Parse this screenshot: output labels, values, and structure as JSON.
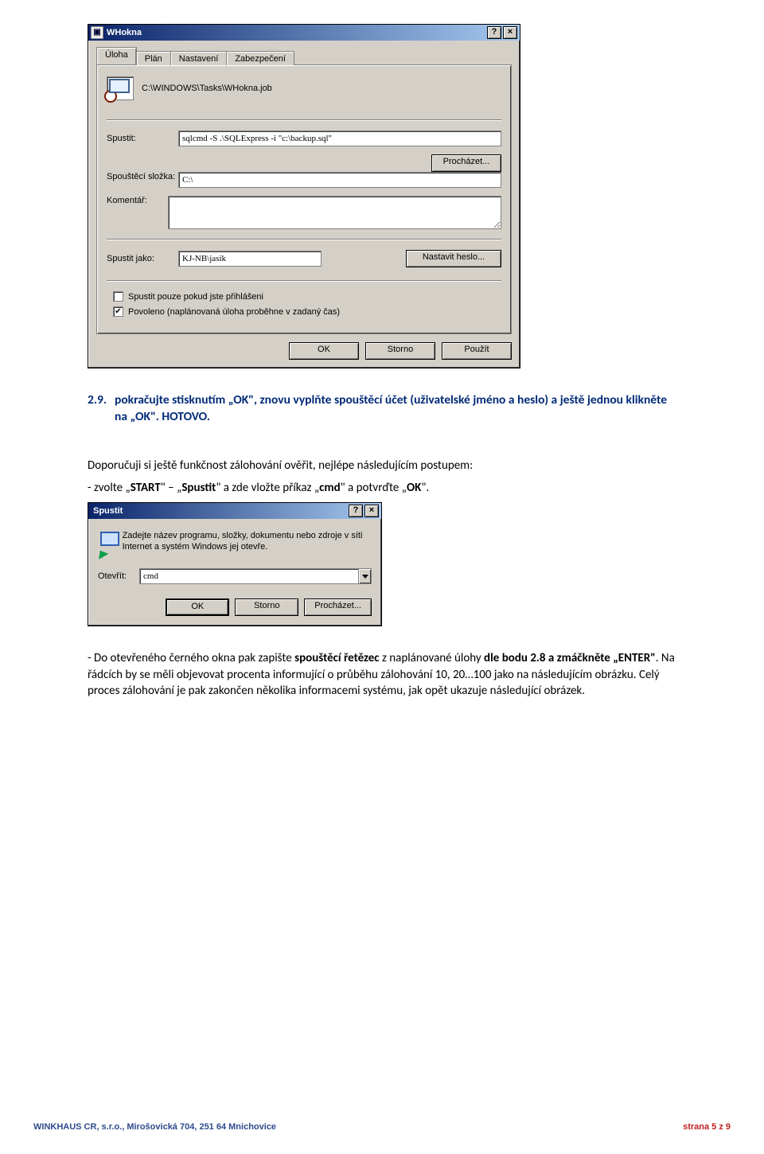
{
  "dialog1": {
    "title": "WHokna",
    "help": "?",
    "close": "×",
    "tabs": [
      "Úloha",
      "Plán",
      "Nastavení",
      "Zabezpečení"
    ],
    "path": "C:\\WINDOWS\\Tasks\\WHokna.job",
    "labels": {
      "spustit": "Spustit:",
      "browse": "Procházet...",
      "startfolder": "Spouštěcí složka:",
      "comment": "Komentář:",
      "runas": "Spustit jako:",
      "setpass": "Nastavit heslo..."
    },
    "values": {
      "command": "sqlcmd -S .\\SQLExpress -i \"c:\\backup.sql\"",
      "folder": "C:\\",
      "runas": "KJ-NB\\jasik"
    },
    "checks": {
      "only_logged": "Spustit pouze pokud jste přihlášeni",
      "enabled": "Povoleno (naplánovaná úloha proběhne v zadaný čas)"
    },
    "buttons": {
      "ok": "OK",
      "storno": "Storno",
      "pouzit": "Použít"
    }
  },
  "doc": {
    "step_num": "2.9.",
    "step_text": "pokračujte stisknutím „OK\", znovu vyplňte spouštěcí účet (uživatelské jméno a heslo) a ještě jednou klikněte na „OK\". HOTOVO.",
    "para1_pre": "Doporučuji si ještě funkčnost zálohování ověřit, nejlépe následujícím postupem:",
    "para1_bullet": "- zvolte „",
    "para1_b1": "START",
    "para1_m1": "\" – „",
    "para1_b2": "Spustit",
    "para1_m2": "\" a zde vložte příkaz „",
    "para1_b3": "cmd",
    "para1_m3": "\" a potvrďte „",
    "para1_b4": "OK",
    "para1_m4": "\".",
    "para2_a": "- Do otevřeného černého okna pak zapište ",
    "para2_b1": "spouštěcí řetězec",
    "para2_b": " z naplánované úlohy ",
    "para2_b2": "dle bodu 2.8 a zmáčkněte „ENTER\"",
    "para2_c": ". Na řádcích by se měli objevovat procenta informující o průběhu zálohování 10, 20…100 jako na následujícím obrázku. Celý proces zálohování je pak zakončen několika informacemi systému, jak opět ukazuje následující obrázek."
  },
  "runDialog": {
    "title": "Spustit",
    "help": "?",
    "close": "×",
    "text": "Zadejte název programu, složky, dokumentu nebo zdroje v síti Internet a systém Windows jej otevře.",
    "openLabel": "Otevřít:",
    "value": "cmd",
    "buttons": {
      "ok": "OK",
      "storno": "Storno",
      "browse": "Procházet..."
    }
  },
  "footer": {
    "left": "WINKHAUS CR, s.r.o., Mirošovická 704, 251 64 Mnichovice",
    "right": "strana 5 z 9"
  }
}
